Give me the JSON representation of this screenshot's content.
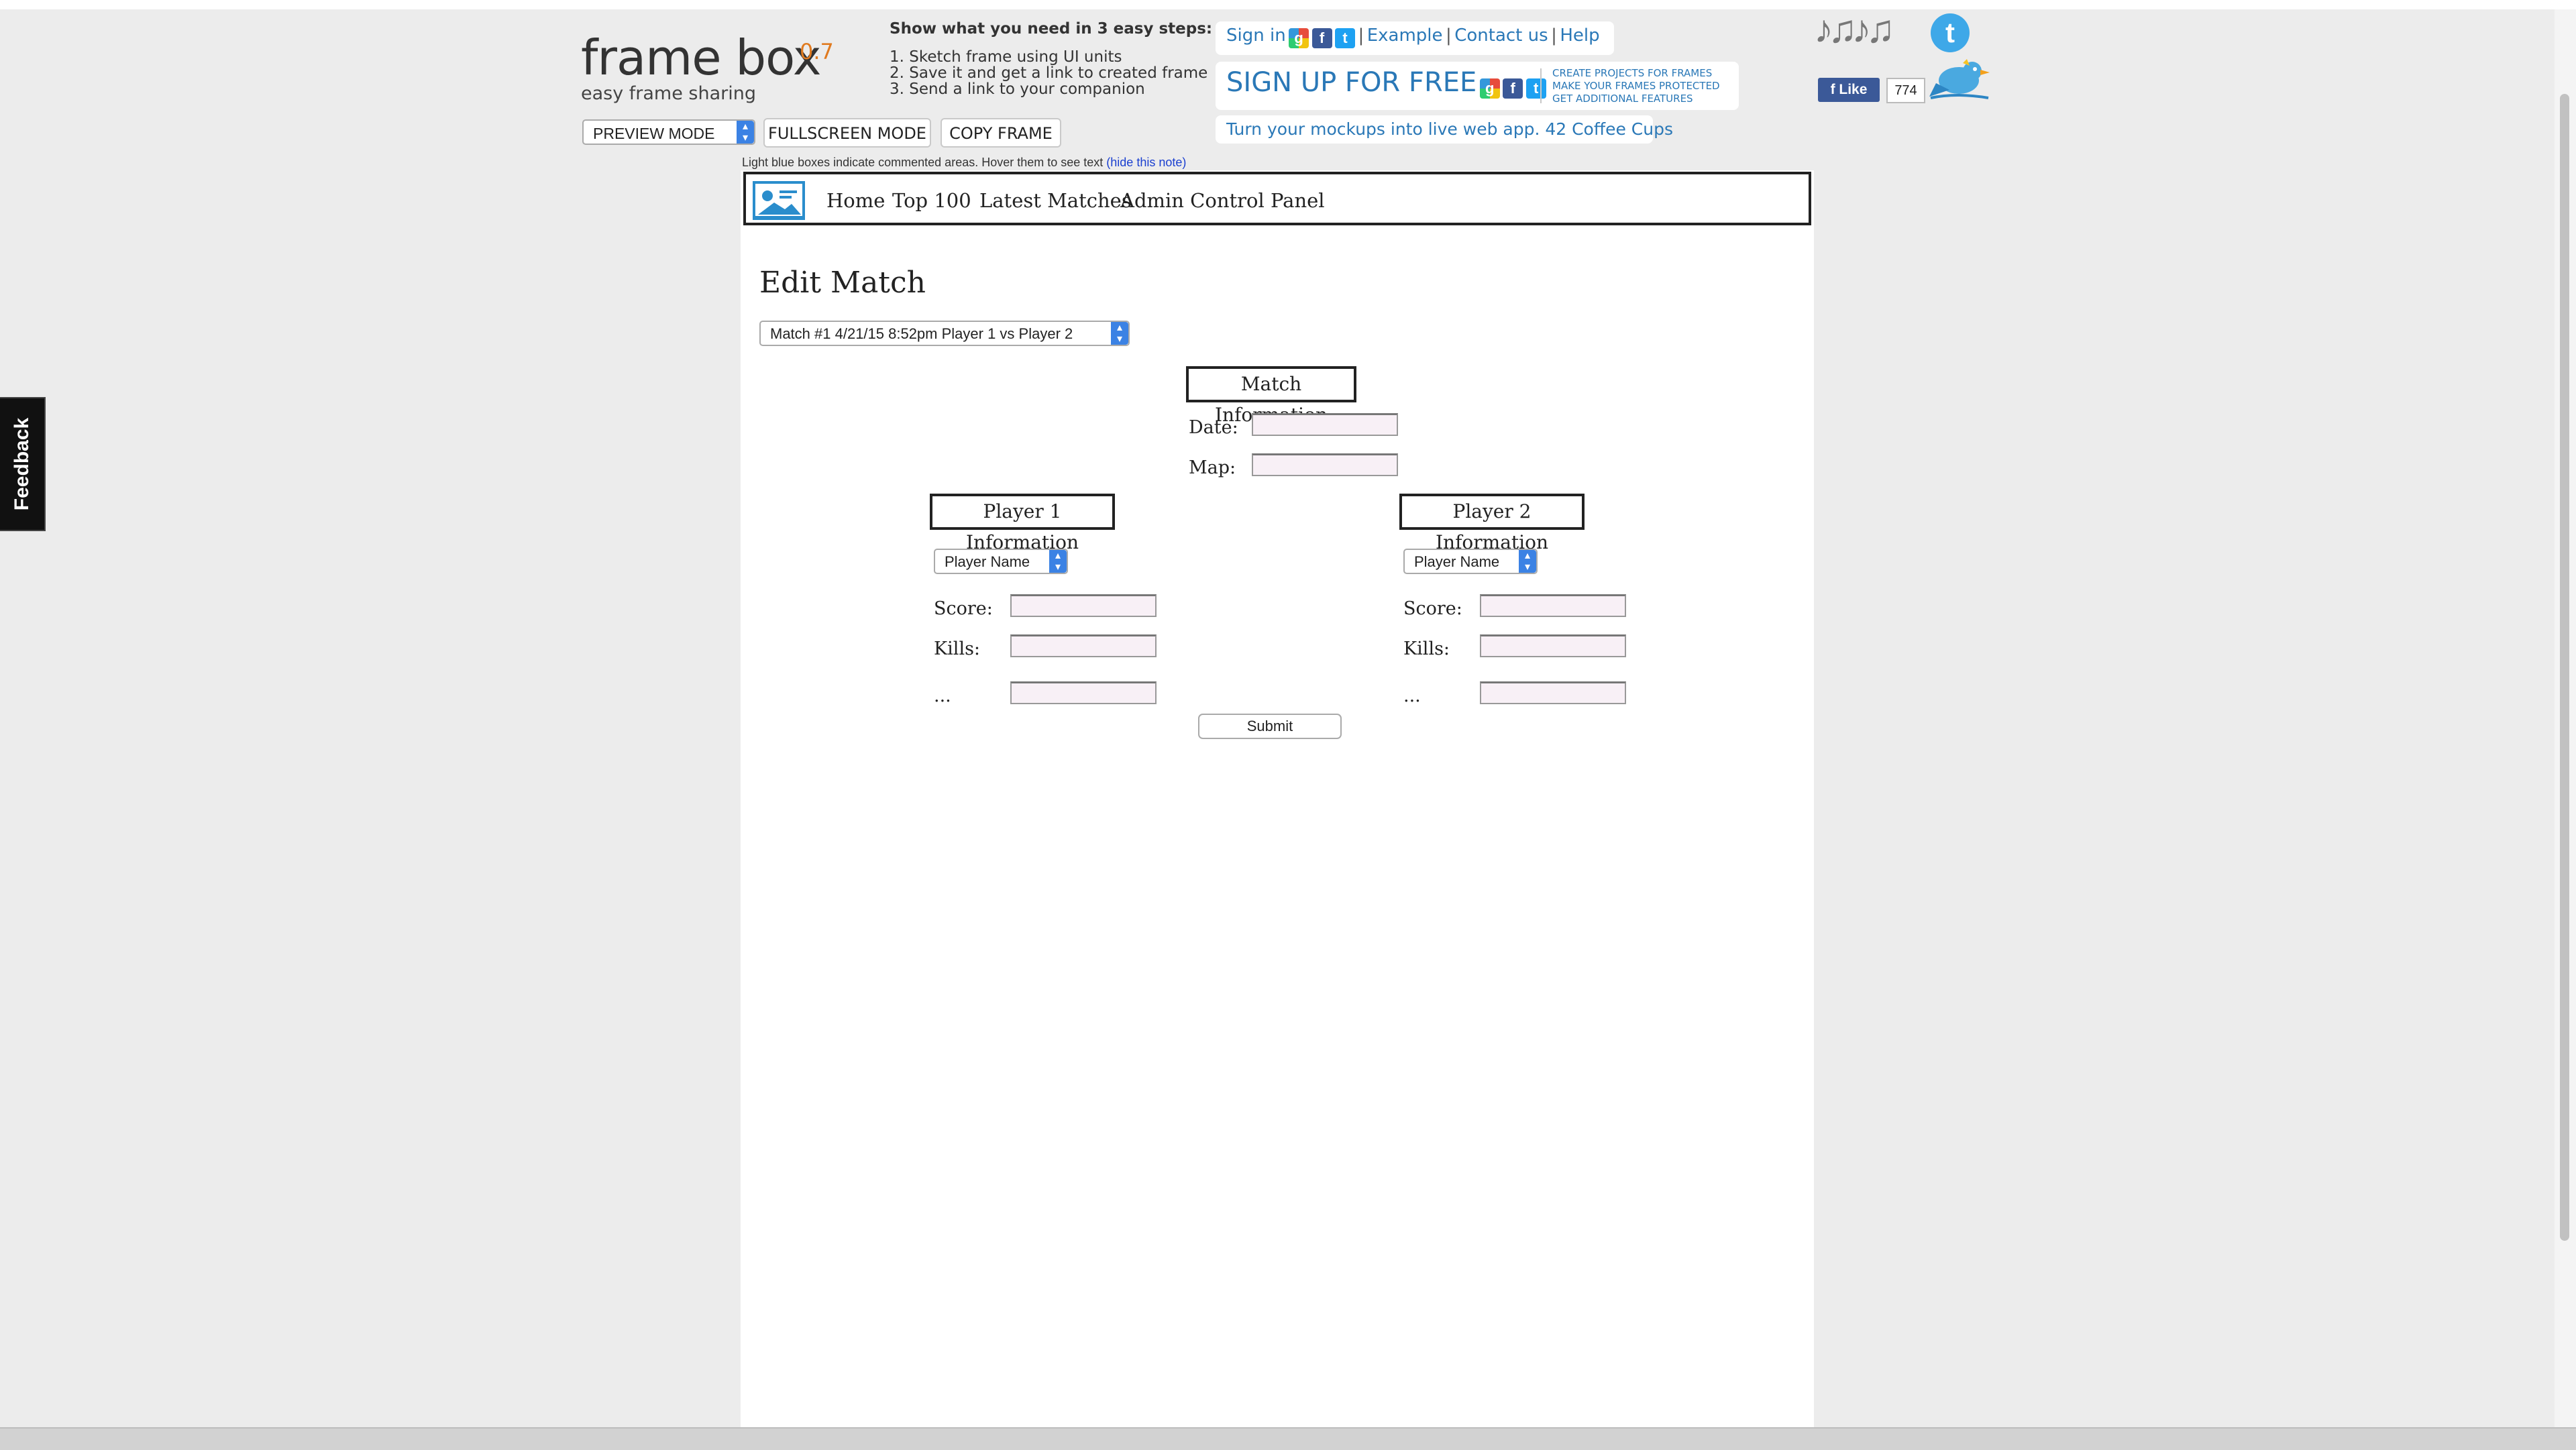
{
  "header": {
    "logo_text": "frame box",
    "logo_version": "0.7",
    "tagline": "easy frame sharing",
    "mode_select": "PREVIEW MODE",
    "fullscreen_label": "FULLSCREEN MODE",
    "copy_label": "COPY FRAME",
    "steps_title": "Show what you need in 3 easy steps:",
    "steps": [
      "1. Sketch frame using UI units",
      "2. Save it and get a link to created frame",
      "3. Send a link to your companion"
    ],
    "signin_label": "Sign in",
    "example_label": "Example",
    "contact_label": "Contact us",
    "help_label": "Help",
    "separator": "|",
    "signup_label": "SIGN UP FOR FREE",
    "signup_features": [
      "CREATE PROJECTS FOR FRAMES",
      "MAKE YOUR FRAMES PROTECTED",
      "GET ADDITIONAL FEATURES"
    ],
    "promo_text": "Turn your mockups into live web app. 42 Coffee Cups",
    "note_text": "Light blue boxes indicate commented areas. Hover them to see text ",
    "note_link": "(hide this note)",
    "fb_like_label": "Like",
    "fb_like_count": "774"
  },
  "feedback_label": "Feedback",
  "mockup": {
    "nav": [
      "Home",
      "Top 100",
      "Latest Matches",
      "Admin Control Panel"
    ],
    "title": "Edit Match",
    "match_select": "Match #1 4/21/15 8:52pm Player 1 vs Player 2",
    "match_info_title": "Match Information",
    "date_label": "Date:",
    "map_label": "Map:",
    "player1": {
      "title": "Player 1 Information",
      "name_select": "Player Name",
      "score_label": "Score:",
      "kills_label": "Kills:",
      "more_label": "..."
    },
    "player2": {
      "title": "Player 2 Information",
      "name_select": "Player Name",
      "score_label": "Score:",
      "kills_label": "Kills:",
      "more_label": "..."
    },
    "submit_label": "Submit"
  },
  "colors": {
    "accent": "#2a78b7",
    "version": "#e07a1f",
    "field_bg": "#f8f0f6"
  }
}
